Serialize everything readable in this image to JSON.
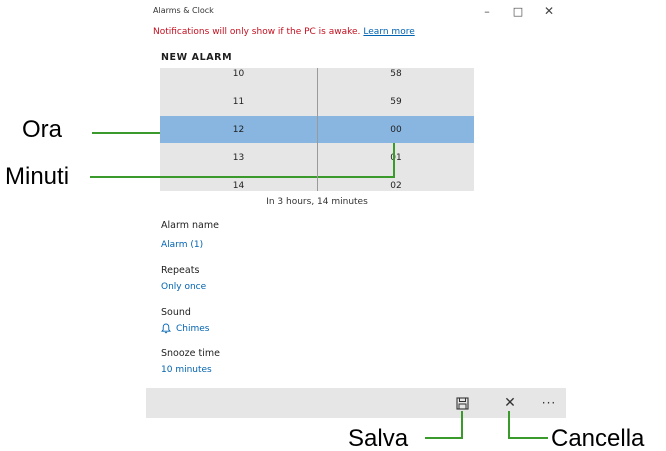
{
  "window": {
    "title": "Alarms & Clock",
    "minimize_glyph": "–",
    "maximize_glyph": "□",
    "close_glyph": "✕"
  },
  "notice": {
    "text": "Notifications will only show if the PC is awake.",
    "link": "Learn more",
    "color": "#c50f1f"
  },
  "heading": "NEW ALARM",
  "picker": {
    "hours": [
      "10",
      "11",
      "12",
      "13",
      "14"
    ],
    "minutes": [
      "58",
      "59",
      "00",
      "01",
      "02"
    ],
    "selected_hour": "12",
    "selected_minute": "00",
    "highlight_color": "#88b6e0"
  },
  "duration": "In 3 hours, 14 minutes",
  "fields": {
    "name": {
      "label": "Alarm name",
      "value": "Alarm (1)"
    },
    "repeats": {
      "label": "Repeats",
      "value": "Only once"
    },
    "sound": {
      "label": "Sound",
      "value": "Chimes",
      "icon": "bell-icon"
    },
    "snooze": {
      "label": "Snooze time",
      "value": "10 minutes"
    }
  },
  "commandbar": {
    "save_icon": "save-icon",
    "cancel_icon": "close-icon",
    "cancel_glyph": "✕",
    "more_icon": "more-icon",
    "more_glyph": "···"
  },
  "callouts": {
    "ora": "Ora",
    "minuti": "Minuti",
    "salva": "Salva",
    "cancella": "Cancella",
    "line_color": "#3a9a2b"
  },
  "accent": "#0063b1"
}
